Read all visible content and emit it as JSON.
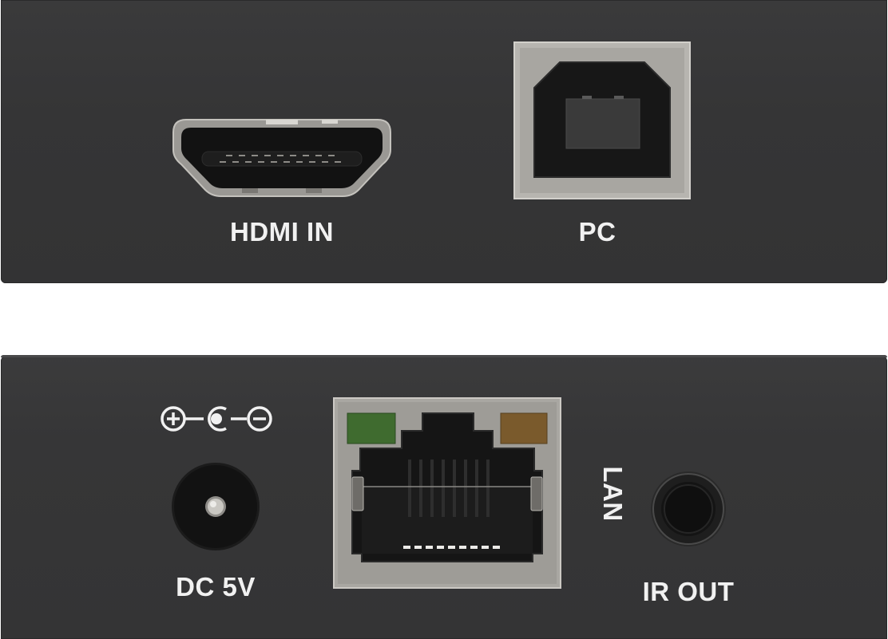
{
  "top_panel": {
    "hdmi_label": "HDMI IN",
    "pc_label": "PC"
  },
  "bottom_panel": {
    "dc_label": "DC 5V",
    "lan_label": "LAN",
    "ir_label": "IR OUT"
  },
  "colors": {
    "chassis": "#363637",
    "label_text": "#f1f1f1",
    "port_metal": "#b4b2ad",
    "led_green": "#3f6b2f",
    "led_amber": "#7a5a2c"
  }
}
